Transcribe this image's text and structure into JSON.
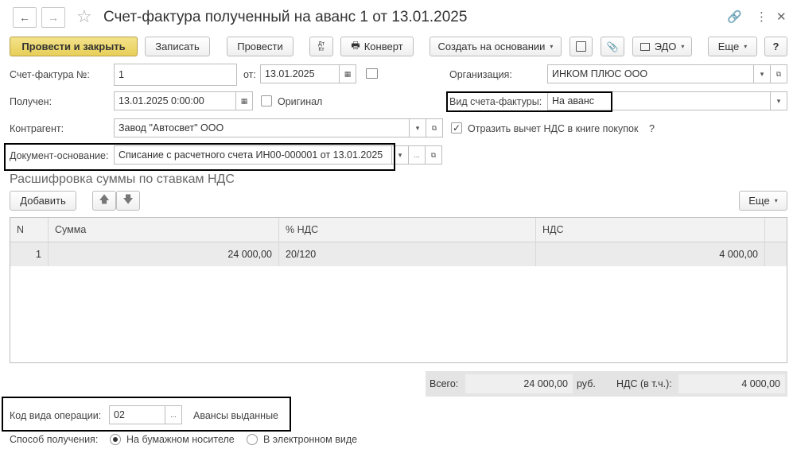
{
  "window": {
    "title": "Счет-фактура полученный на аванс 1 от 13.01.2025"
  },
  "icons": {
    "back": "←",
    "forward": "→",
    "star": "☆",
    "link": "🔗",
    "more": "⋮",
    "close": "✕",
    "calendar": "▦",
    "dropdown": "▾",
    "open": "⧉",
    "ellipsis": "...",
    "check": "✓",
    "print": "🖶",
    "attach": "📎",
    "arrow_up": "🡅",
    "arrow_down": "🡇"
  },
  "toolbar": {
    "post_close": "Провести и закрыть",
    "save": "Записать",
    "post": "Провести",
    "dtkt_top": "Дт",
    "dtkt_bottom": "Кт",
    "envelope": "Конверт",
    "create_based": "Создать на основании",
    "edo": "ЭДО",
    "more": "Еще",
    "help": "?"
  },
  "form": {
    "invoice_no_label": "Счет-фактура №:",
    "invoice_no_value": "1",
    "from_label": "от:",
    "from_value": "13.01.2025",
    "organization_label": "Организация:",
    "organization_value": "ИНКОМ ПЛЮС ООО",
    "received_label": "Получен:",
    "received_value": "13.01.2025  0:00:00",
    "original_label": "Оригинал",
    "invoice_type_label": "Вид счета-фактуры:",
    "invoice_type_value": "На аванс",
    "counterparty_label": "Контрагент:",
    "counterparty_value": "Завод \"Автосвет\" ООО",
    "reflect_vat_label": "Отразить вычет НДС в книге покупок",
    "reflect_vat_help": "?",
    "base_doc_label": "Документ-основание:",
    "base_doc_value": "Списание с расчетного счета ИН00-000001 от 13.01.2025"
  },
  "section": {
    "title": "Расшифровка суммы по ставкам НДС",
    "add": "Добавить",
    "more": "Еще"
  },
  "table": {
    "headers": [
      "N",
      "Сумма",
      "% НДС",
      "НДС"
    ],
    "rows": [
      {
        "n": "1",
        "sum": "24 000,00",
        "rate": "20/120",
        "vat": "4 000,00"
      }
    ]
  },
  "totals": {
    "total_label": "Всего:",
    "total_value": "24 000,00",
    "currency": "руб.",
    "vat_label": "НДС (в т.ч.):",
    "vat_value": "4 000,00"
  },
  "footer": {
    "op_code_label": "Код вида операции:",
    "op_code_value": "02",
    "op_code_desc": "Авансы выданные",
    "receipt_label": "Способ получения:",
    "paper": "На бумажном носителе",
    "electronic": "В электронном виде"
  }
}
